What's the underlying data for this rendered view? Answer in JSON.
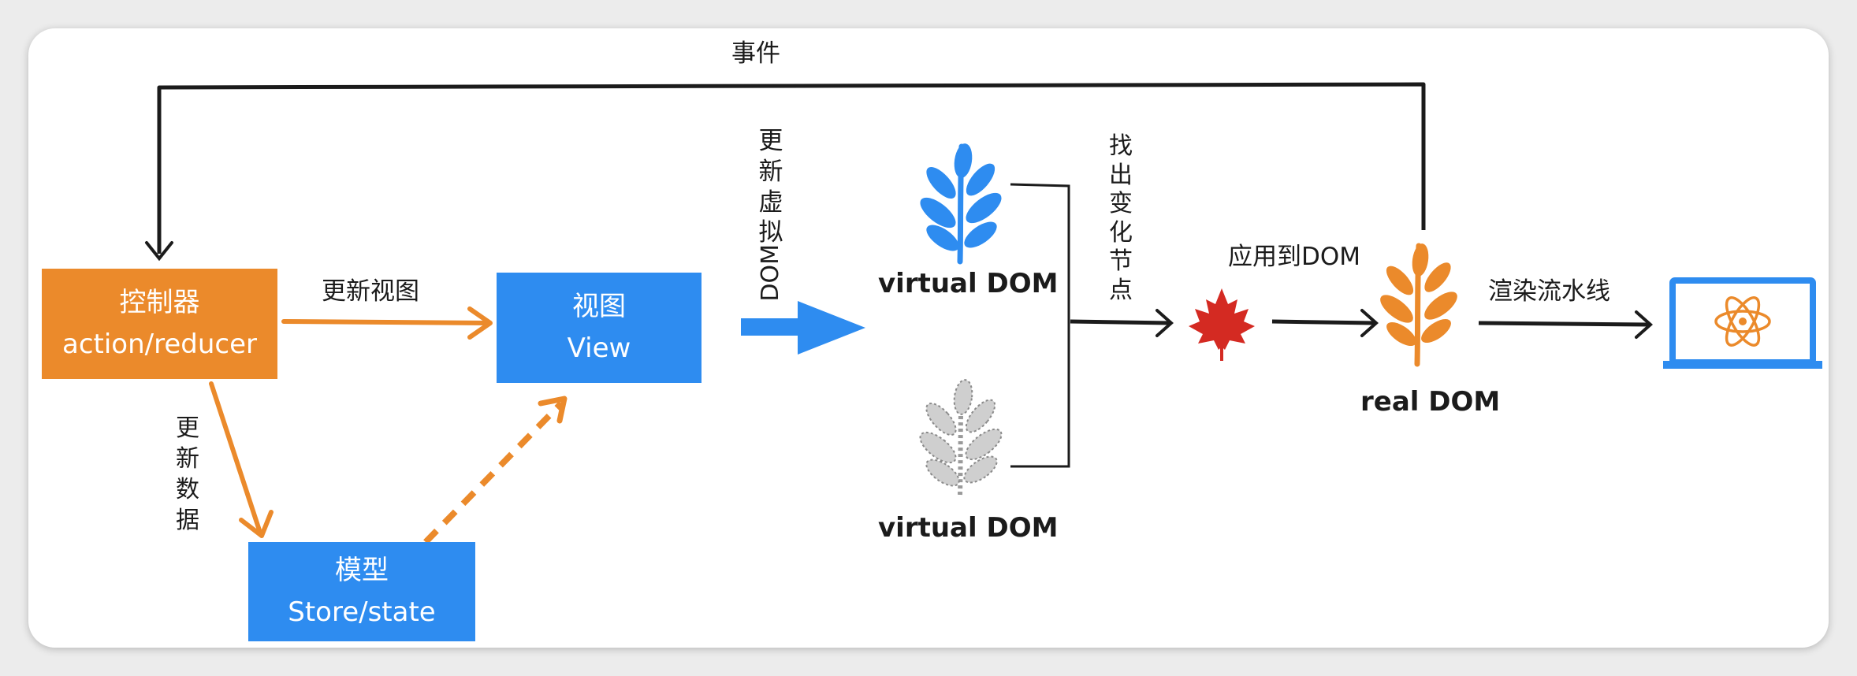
{
  "events_label": "事件",
  "controller": {
    "title": "控制器",
    "subtitle": "action/reducer"
  },
  "view": {
    "title": "视图",
    "subtitle": "View"
  },
  "model": {
    "title": "模型",
    "subtitle": "Store/state"
  },
  "update_view_label": "更新视图",
  "update_data_chars": [
    "更",
    "新",
    "数",
    "据"
  ],
  "update_vdom_chars": [
    "更",
    "新",
    "虚",
    "拟"
  ],
  "update_vdom_dom": "DOM",
  "find_changes_chars": [
    "找",
    "出",
    "变",
    "化",
    "节",
    "点"
  ],
  "apply_to_dom_label": "应用到DOM",
  "render_pipeline_label": "渲染流水线",
  "virtual_dom_new_label": "virtual DOM",
  "virtual_dom_old_label": "virtual DOM",
  "real_dom_label": "real DOM",
  "colors": {
    "orange": "#eb8a2b",
    "blue": "#2e8cf0",
    "red_leaf": "#d42a22",
    "grey_tree": "#bdbdbd",
    "line": "#1b1b1b"
  },
  "icons": {
    "blue_tree": "blue-tree-icon",
    "grey_tree": "grey-dotted-tree-icon",
    "maple_leaf": "red-maple-leaf-icon",
    "orange_tree": "orange-tree-icon",
    "laptop": "laptop-atom-icon"
  }
}
